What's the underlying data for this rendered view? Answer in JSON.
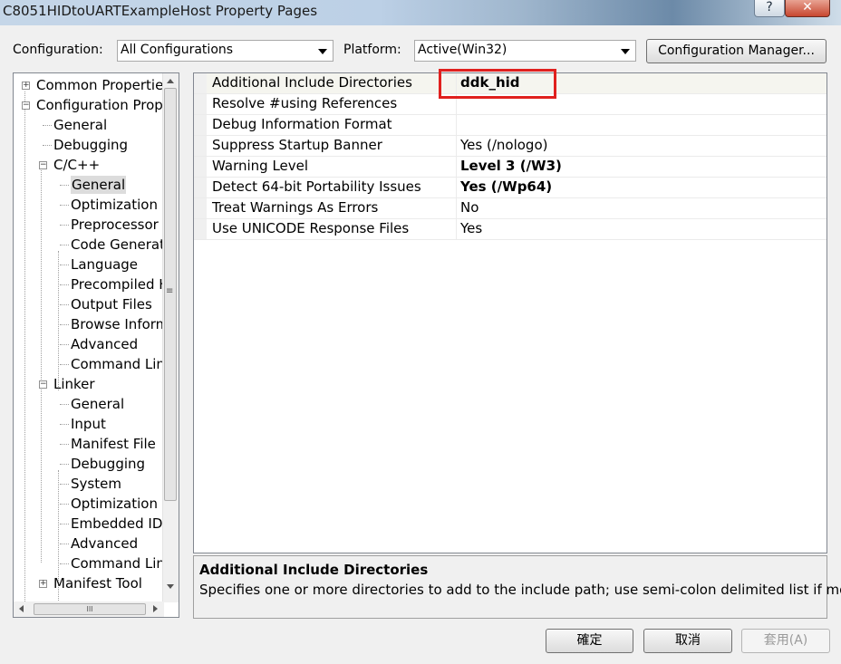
{
  "window": {
    "title": "C8051HIDtoUARTExampleHost Property Pages",
    "help_button": "?",
    "close_button": "✕"
  },
  "toolbar": {
    "configuration_label": "Configuration:",
    "configuration_value": "All Configurations",
    "platform_label": "Platform:",
    "platform_value": "Active(Win32)",
    "config_manager_button": "Configuration Manager..."
  },
  "tree": {
    "items": [
      {
        "label": "Common Properties",
        "expander": "+"
      },
      {
        "label": "Configuration Prope",
        "expander": "−"
      },
      {
        "label": "General"
      },
      {
        "label": "Debugging"
      },
      {
        "label": "C/C++",
        "expander": "−"
      },
      {
        "label": "General",
        "selected": true
      },
      {
        "label": "Optimization"
      },
      {
        "label": "Preprocessor"
      },
      {
        "label": "Code Generati"
      },
      {
        "label": "Language"
      },
      {
        "label": "Precompiled H"
      },
      {
        "label": "Output Files"
      },
      {
        "label": "Browse Inform"
      },
      {
        "label": "Advanced"
      },
      {
        "label": "Command Lin"
      },
      {
        "label": "Linker",
        "expander": "−"
      },
      {
        "label": "General"
      },
      {
        "label": "Input"
      },
      {
        "label": "Manifest File"
      },
      {
        "label": "Debugging"
      },
      {
        "label": "System"
      },
      {
        "label": "Optimization"
      },
      {
        "label": "Embedded IDI"
      },
      {
        "label": "Advanced"
      },
      {
        "label": "Command Lin"
      },
      {
        "label": "Manifest Tool",
        "expander": "+"
      }
    ],
    "scroll_grip": "≡",
    "hscroll_grip": "III"
  },
  "properties": [
    {
      "name": "Additional Include Directories",
      "value": "ddk_hid",
      "bold": true
    },
    {
      "name": "Resolve #using References",
      "value": ""
    },
    {
      "name": "Debug Information Format",
      "value": ""
    },
    {
      "name": "Suppress Startup Banner",
      "value": "Yes (/nologo)"
    },
    {
      "name": "Warning Level",
      "value": "Level 3 (/W3)",
      "bold": true
    },
    {
      "name": "Detect 64-bit Portability Issues",
      "value": "Yes (/Wp64)",
      "bold": true
    },
    {
      "name": "Treat Warnings As Errors",
      "value": "No"
    },
    {
      "name": "Use UNICODE Response Files",
      "value": "Yes"
    }
  ],
  "description": {
    "title": "Additional Include Directories",
    "text": "Specifies one or more directories to add to the include path; use semi-colon delimited list if more..."
  },
  "buttons": {
    "ok": "確定",
    "cancel": "取消",
    "apply": "套用(A)"
  },
  "colors": {
    "highlight_box": "#e0201e"
  }
}
